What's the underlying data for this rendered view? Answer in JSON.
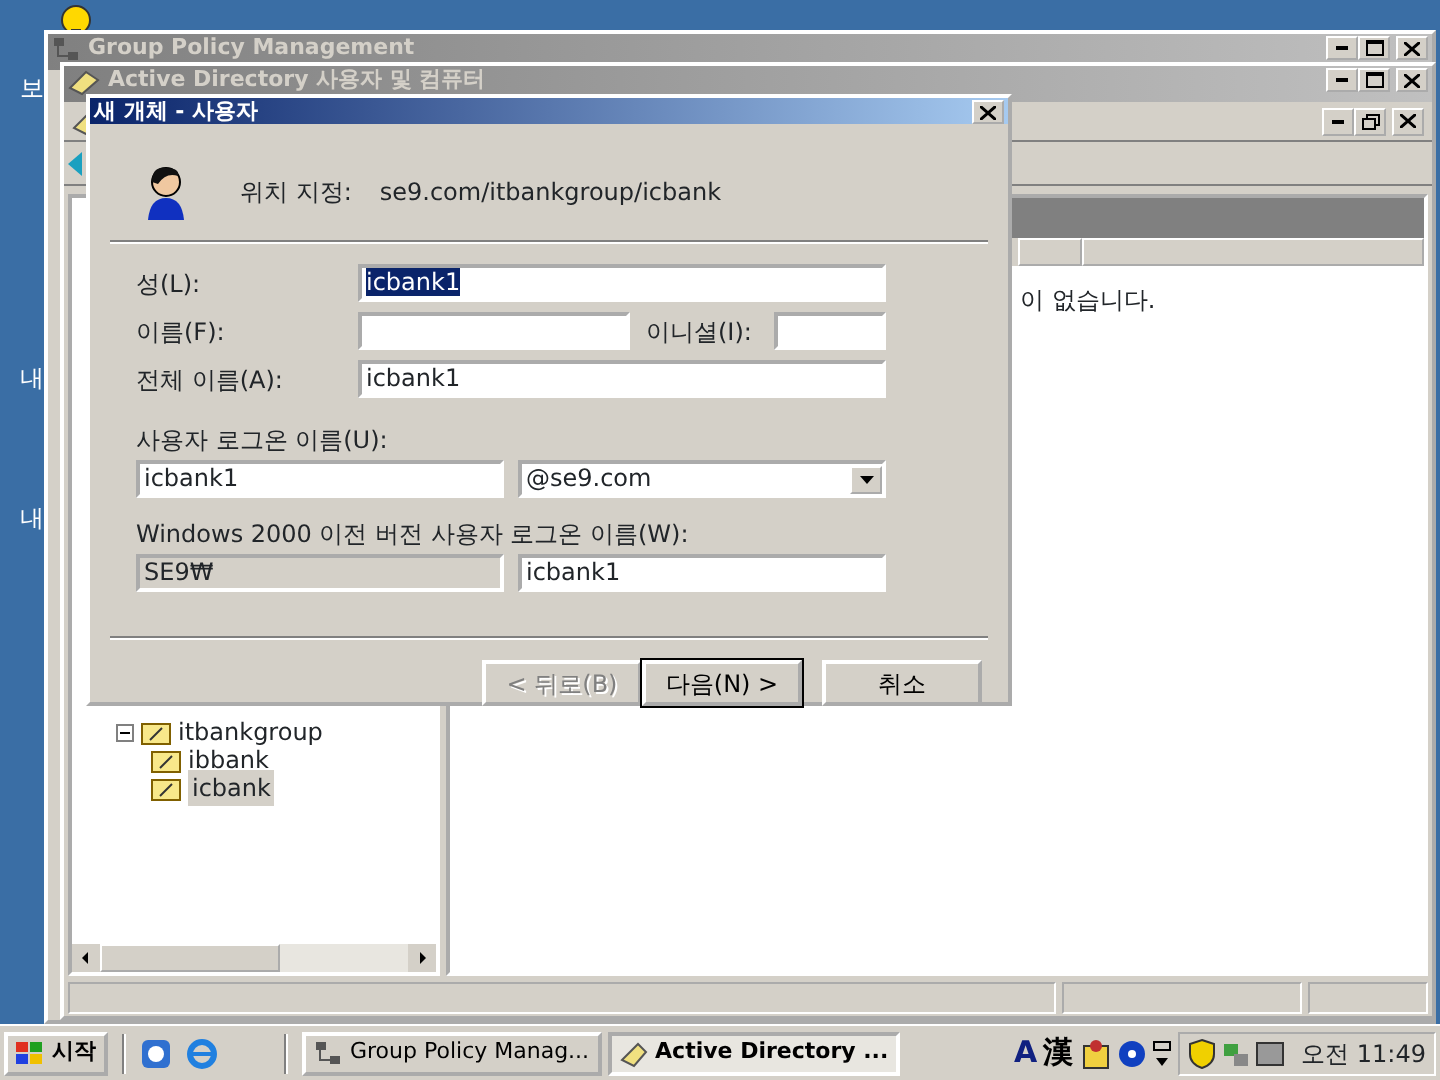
{
  "desktop": {
    "labels": [
      "보",
      "내",
      "내"
    ]
  },
  "gpm_window": {
    "title": "Group Policy Management",
    "active": false
  },
  "ad_window": {
    "title": "Active Directory 사용자 및 컴퓨터",
    "active": false,
    "tree": [
      {
        "label": "itbankgroup",
        "expanded": true,
        "selected": false,
        "children": [
          {
            "label": "ibbank",
            "selected": false
          },
          {
            "label": "icbank",
            "selected": true
          }
        ]
      }
    ],
    "list_message": "이 없습니다."
  },
  "dialog": {
    "title": "새 개체 - 사용자",
    "active": true,
    "location_label": "위치 지정:",
    "location": "se9.com/itbankgroup/icbank",
    "last_name": {
      "label": "성(L):",
      "value": "icbank1",
      "selected": true
    },
    "first_name": {
      "label": "이름(F):"
    },
    "initials": {
      "label": "이니셜(I):"
    },
    "full_name": {
      "label": "전체 이름(A):",
      "value": "icbank1"
    },
    "logon_name": {
      "label": "사용자 로그온 이름(U):",
      "value": "icbank1",
      "domain": "@se9.com"
    },
    "pre2000": {
      "label": "Windows 2000 이전 버전 사용자 로그온 이름(W):",
      "domain": "SE9₩",
      "domain_disabled": true,
      "value": "icbank1"
    },
    "buttons": [
      {
        "label": "< 뒤로(B)",
        "disabled": true,
        "default": false
      },
      {
        "label": "다음(N) >",
        "disabled": false,
        "default": true
      },
      {
        "label": "취소",
        "disabled": false,
        "default": false
      }
    ]
  },
  "taskbar": {
    "start": "시작",
    "tasks": [
      {
        "label": "Group Policy Manag...",
        "selected": false
      },
      {
        "label": "Active Directory ...",
        "selected": true
      }
    ],
    "ime": [
      "A",
      "漢"
    ],
    "clock": "오전 11:49"
  }
}
